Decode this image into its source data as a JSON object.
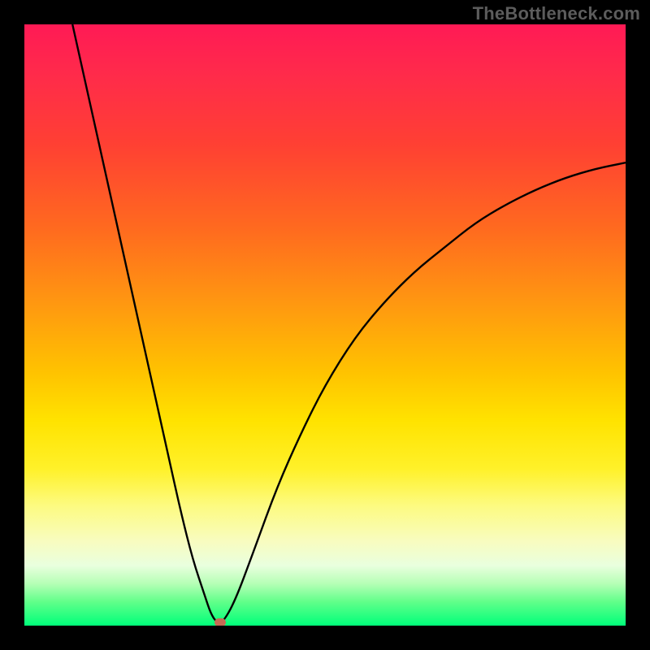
{
  "watermark": "TheBottleneck.com",
  "colors": {
    "curve": "#000000",
    "marker": "#c66a54",
    "frame": "#000000"
  },
  "chart_data": {
    "type": "line",
    "title": "",
    "xlabel": "",
    "ylabel": "",
    "xlim": [
      0,
      100
    ],
    "ylim": [
      0,
      100
    ],
    "grid": false,
    "series": [
      {
        "name": "bottleneck-curve",
        "x": [
          8,
          10,
          12,
          14,
          16,
          18,
          20,
          22,
          24,
          26,
          28,
          30,
          31,
          32,
          33,
          35,
          38,
          42,
          46,
          50,
          55,
          60,
          65,
          70,
          75,
          80,
          85,
          90,
          95,
          100
        ],
        "y": [
          100,
          91,
          82,
          73,
          64,
          55,
          46,
          37,
          28,
          19,
          11,
          5,
          2,
          0.5,
          0.5,
          4,
          12,
          23,
          32,
          40,
          48,
          54,
          59,
          63,
          67,
          70,
          72.5,
          74.5,
          76,
          77
        ]
      }
    ],
    "marker": {
      "x": 32.5,
      "y": 0.5
    },
    "background_gradient": {
      "orientation": "vertical",
      "stops": [
        {
          "pos": 0.0,
          "color": "#ff1a55"
        },
        {
          "pos": 0.2,
          "color": "#ff4033"
        },
        {
          "pos": 0.46,
          "color": "#ff9611"
        },
        {
          "pos": 0.66,
          "color": "#ffe300"
        },
        {
          "pos": 0.86,
          "color": "#f8fcc0"
        },
        {
          "pos": 1.0,
          "color": "#00ff7a"
        }
      ]
    }
  }
}
